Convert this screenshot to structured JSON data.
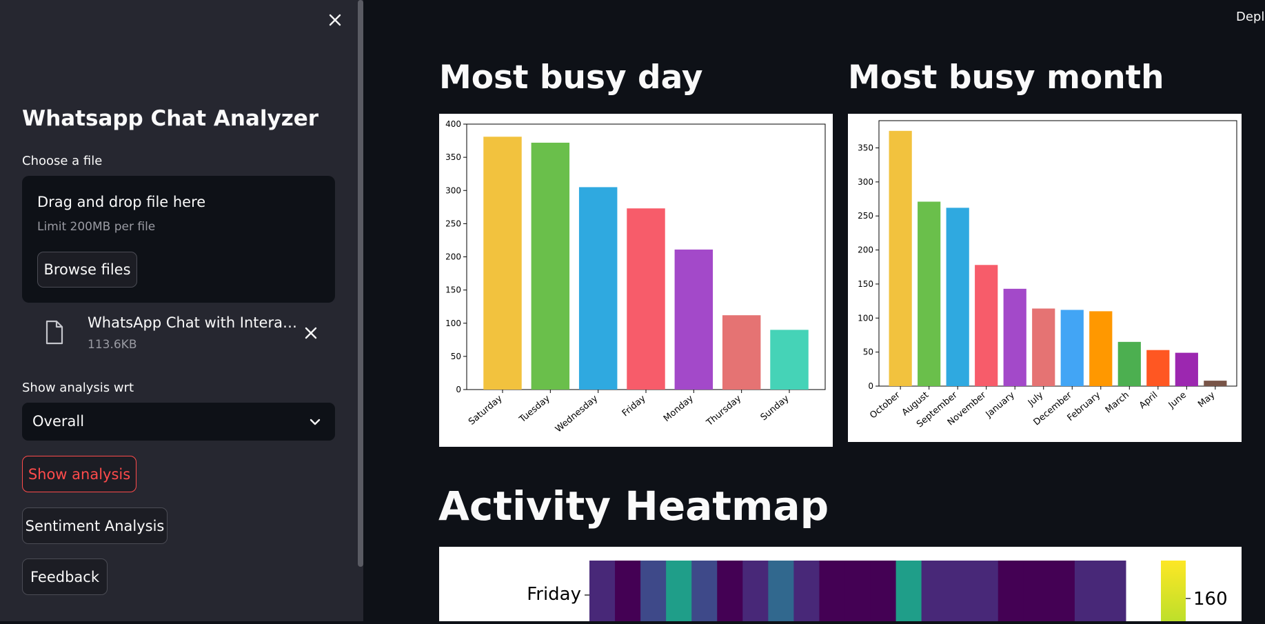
{
  "sidebar": {
    "title": "Whatsapp Chat Analyzer",
    "file_label": "Choose a file",
    "dropzone_text": "Drag and drop file here",
    "dropzone_limit": "Limit 200MB per file",
    "browse_label": "Browse files",
    "file_name": "WhatsApp Chat with Interaction with ...",
    "file_size": "113.6KB",
    "select_label": "Show analysis wrt",
    "select_value": "Overall",
    "show_analysis_label": "Show analysis",
    "sentiment_label": "Sentiment Analysis",
    "feedback_label": "Feedback",
    "close_icon": "close-icon",
    "file_icon": "file-icon",
    "chevron_icon": "chevron-down-icon"
  },
  "header": {
    "deploy_label": "Deploy"
  },
  "sections": {
    "busy_day_title": "Most busy day",
    "busy_month_title": "Most busy month",
    "heatmap_title": "Activity Heatmap"
  },
  "colors": {
    "background": "#0e1117",
    "sidebar": "#262730",
    "accent_red": "#ff4b4b"
  },
  "chart_data": [
    {
      "type": "bar",
      "categories": [
        "Saturday",
        "Tuesday",
        "Wednesday",
        "Friday",
        "Monday",
        "Thursday",
        "Sunday"
      ],
      "values": [
        381,
        372,
        305,
        273,
        211,
        112,
        90
      ],
      "colors": [
        "#f2c23e",
        "#6abf4b",
        "#2fa9e0",
        "#f75c6a",
        "#a349c9",
        "#e57373",
        "#45d3b7"
      ],
      "yticks": [
        0,
        50,
        100,
        150,
        200,
        250,
        300,
        350,
        400
      ],
      "ylim": [
        0,
        400
      ]
    },
    {
      "type": "bar",
      "categories": [
        "October",
        "August",
        "September",
        "November",
        "January",
        "July",
        "December",
        "February",
        "March",
        "April",
        "June",
        "May"
      ],
      "values": [
        375,
        271,
        262,
        178,
        143,
        114,
        112,
        110,
        65,
        53,
        49,
        8
      ],
      "colors": [
        "#f2c23e",
        "#6abf4b",
        "#2fa9e0",
        "#f75c6a",
        "#a349c9",
        "#e57373",
        "#42a5f5",
        "#ff9800",
        "#4caf50",
        "#ff5722",
        "#9c27b0",
        "#795548"
      ],
      "yticks": [
        0,
        50,
        100,
        150,
        200,
        250,
        300,
        350
      ],
      "ylim": [
        0,
        390
      ]
    },
    {
      "type": "heatmap",
      "row_labels": [
        "Friday"
      ],
      "colorbar_ticks": [
        160
      ],
      "cells": [
        [
          20,
          15,
          50,
          90,
          40,
          15,
          25,
          55,
          30,
          8,
          8,
          8,
          90,
          20,
          25,
          20,
          12,
          12,
          12,
          25,
          30
        ]
      ]
    }
  ]
}
